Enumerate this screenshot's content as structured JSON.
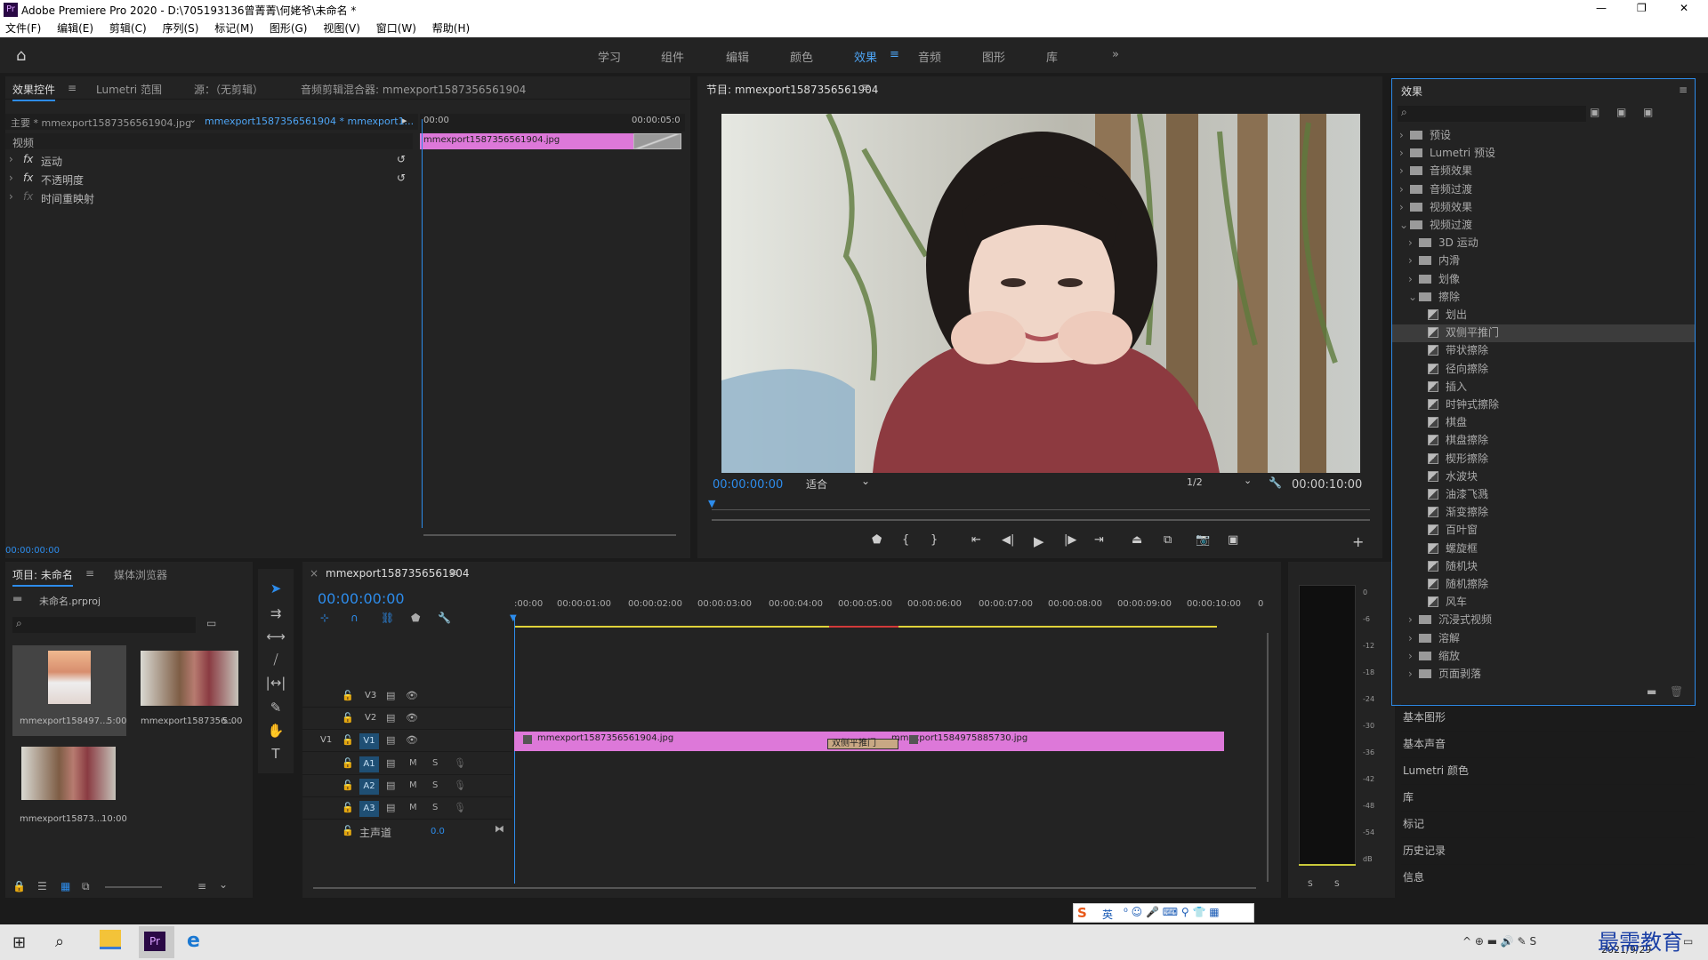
{
  "window": {
    "title": "Adobe Premiere Pro 2020 - D:\\705193136曾菁菁\\何姥爷\\未命名 *",
    "controls": [
      "—",
      "❐",
      "✕"
    ]
  },
  "menu": [
    "文件(F)",
    "编辑(E)",
    "剪辑(C)",
    "序列(S)",
    "标记(M)",
    "图形(G)",
    "视图(V)",
    "窗口(W)",
    "帮助(H)"
  ],
  "workspaces": [
    "学习",
    "组件",
    "编辑",
    "颜色",
    "效果",
    "音频",
    "图形",
    "库"
  ],
  "workspace_active": "效果",
  "source_panel": {
    "tabs": [
      "效果控件",
      "Lumetri 范围",
      "源：（无剪辑）",
      "音频剪辑混合器: mmexport1587356561904"
    ],
    "master": "主要 * mmexport1587356561904.jpg",
    "sequence_clip": "mmexport1587356561904 * mmexport1...",
    "ruler_start": "00:00",
    "ruler_end": "00:00:05:0",
    "clip_name": "mmexport1587356561904.jpg",
    "section": "视频",
    "effects": [
      "运动",
      "不透明度",
      "时间重映射"
    ],
    "timecode": "00:00:00:00"
  },
  "program_monitor": {
    "title": "节目: mmexport1587356561904",
    "timecode": "00:00:00:00",
    "fit": "适合",
    "resolution": "1/2",
    "duration": "00:00:10:00"
  },
  "project_panel": {
    "tabs": [
      "项目: 未命名",
      "媒体浏览器"
    ],
    "file": "未命名.prproj",
    "items": [
      {
        "name": "mmexport158497...",
        "dur": "5:00"
      },
      {
        "name": "mmexport1587356...",
        "dur": "5:00"
      },
      {
        "name": "mmexport15873...",
        "dur": "10:00"
      }
    ]
  },
  "timeline": {
    "tab": "mmexport1587356561904",
    "timecode": "00:00:00:00",
    "ruler": [
      ":00:00",
      "00:00:01:00",
      "00:00:02:00",
      "00:00:03:00",
      "00:00:04:00",
      "00:00:05:00",
      "00:00:06:00",
      "00:00:07:00",
      "00:00:08:00",
      "00:00:09:00",
      "00:00:10:00",
      "0"
    ],
    "video_tracks": [
      "V3",
      "V2",
      "V1"
    ],
    "audio_tracks": [
      "A1",
      "A2",
      "A3"
    ],
    "v1_src": "V1",
    "master": "主声道",
    "master_vol": "0.0",
    "clip1": "mmexport1587356561904.jpg",
    "clip2": "mmexport1584975885730.jpg",
    "transition": "双侧平推门",
    "m_label": "M",
    "s_label": "S"
  },
  "meter": {
    "scale": [
      "0",
      "-6",
      "-12",
      "-18",
      "-24",
      "-30",
      "-36",
      "-42",
      "-48",
      "-54",
      "dB"
    ],
    "solo": [
      "S",
      "S"
    ]
  },
  "effects_panel": {
    "title": "效果",
    "tree": [
      {
        "label": "预设",
        "level": 0,
        "kind": "folder",
        "open": false
      },
      {
        "label": "Lumetri 预设",
        "level": 0,
        "kind": "folder",
        "open": false
      },
      {
        "label": "音频效果",
        "level": 0,
        "kind": "folder",
        "open": false
      },
      {
        "label": "音频过渡",
        "level": 0,
        "kind": "folder",
        "open": false
      },
      {
        "label": "视频效果",
        "level": 0,
        "kind": "folder",
        "open": false
      },
      {
        "label": "视频过渡",
        "level": 0,
        "kind": "folder",
        "open": true
      },
      {
        "label": "3D 运动",
        "level": 1,
        "kind": "folder",
        "open": false
      },
      {
        "label": "内滑",
        "level": 1,
        "kind": "folder",
        "open": false
      },
      {
        "label": "划像",
        "level": 1,
        "kind": "folder",
        "open": false
      },
      {
        "label": "擦除",
        "level": 1,
        "kind": "folder",
        "open": true
      },
      {
        "label": "划出",
        "level": 2,
        "kind": "fx"
      },
      {
        "label": "双侧平推门",
        "level": 2,
        "kind": "fx",
        "selected": true
      },
      {
        "label": "带状擦除",
        "level": 2,
        "kind": "fx"
      },
      {
        "label": "径向擦除",
        "level": 2,
        "kind": "fx"
      },
      {
        "label": "插入",
        "level": 2,
        "kind": "fx"
      },
      {
        "label": "时钟式擦除",
        "level": 2,
        "kind": "fx"
      },
      {
        "label": "棋盘",
        "level": 2,
        "kind": "fx"
      },
      {
        "label": "棋盘擦除",
        "level": 2,
        "kind": "fx"
      },
      {
        "label": "楔形擦除",
        "level": 2,
        "kind": "fx"
      },
      {
        "label": "水波块",
        "level": 2,
        "kind": "fx"
      },
      {
        "label": "油漆飞溅",
        "level": 2,
        "kind": "fx"
      },
      {
        "label": "渐变擦除",
        "level": 2,
        "kind": "fx"
      },
      {
        "label": "百叶窗",
        "level": 2,
        "kind": "fx"
      },
      {
        "label": "螺旋框",
        "level": 2,
        "kind": "fx"
      },
      {
        "label": "随机块",
        "level": 2,
        "kind": "fx"
      },
      {
        "label": "随机擦除",
        "level": 2,
        "kind": "fx"
      },
      {
        "label": "风车",
        "level": 2,
        "kind": "fx"
      },
      {
        "label": "沉浸式视频",
        "level": 1,
        "kind": "folder",
        "open": false
      },
      {
        "label": "溶解",
        "level": 1,
        "kind": "folder",
        "open": false
      },
      {
        "label": "缩放",
        "level": 1,
        "kind": "folder",
        "open": false
      },
      {
        "label": "页面剥落",
        "level": 1,
        "kind": "folder",
        "open": false
      }
    ]
  },
  "side_panels": [
    "基本图形",
    "基本声音",
    "Lumetri 颜色",
    "库",
    "标记",
    "历史记录",
    "信息"
  ],
  "ime": {
    "brand": "S",
    "lang": "英"
  },
  "taskbar": {
    "date": "2021/9/29",
    "watermark": "最需教育"
  },
  "colors": {
    "accent": "#2d8ceb",
    "clip": "#dd78d9",
    "track_label": "#1f4f74"
  }
}
